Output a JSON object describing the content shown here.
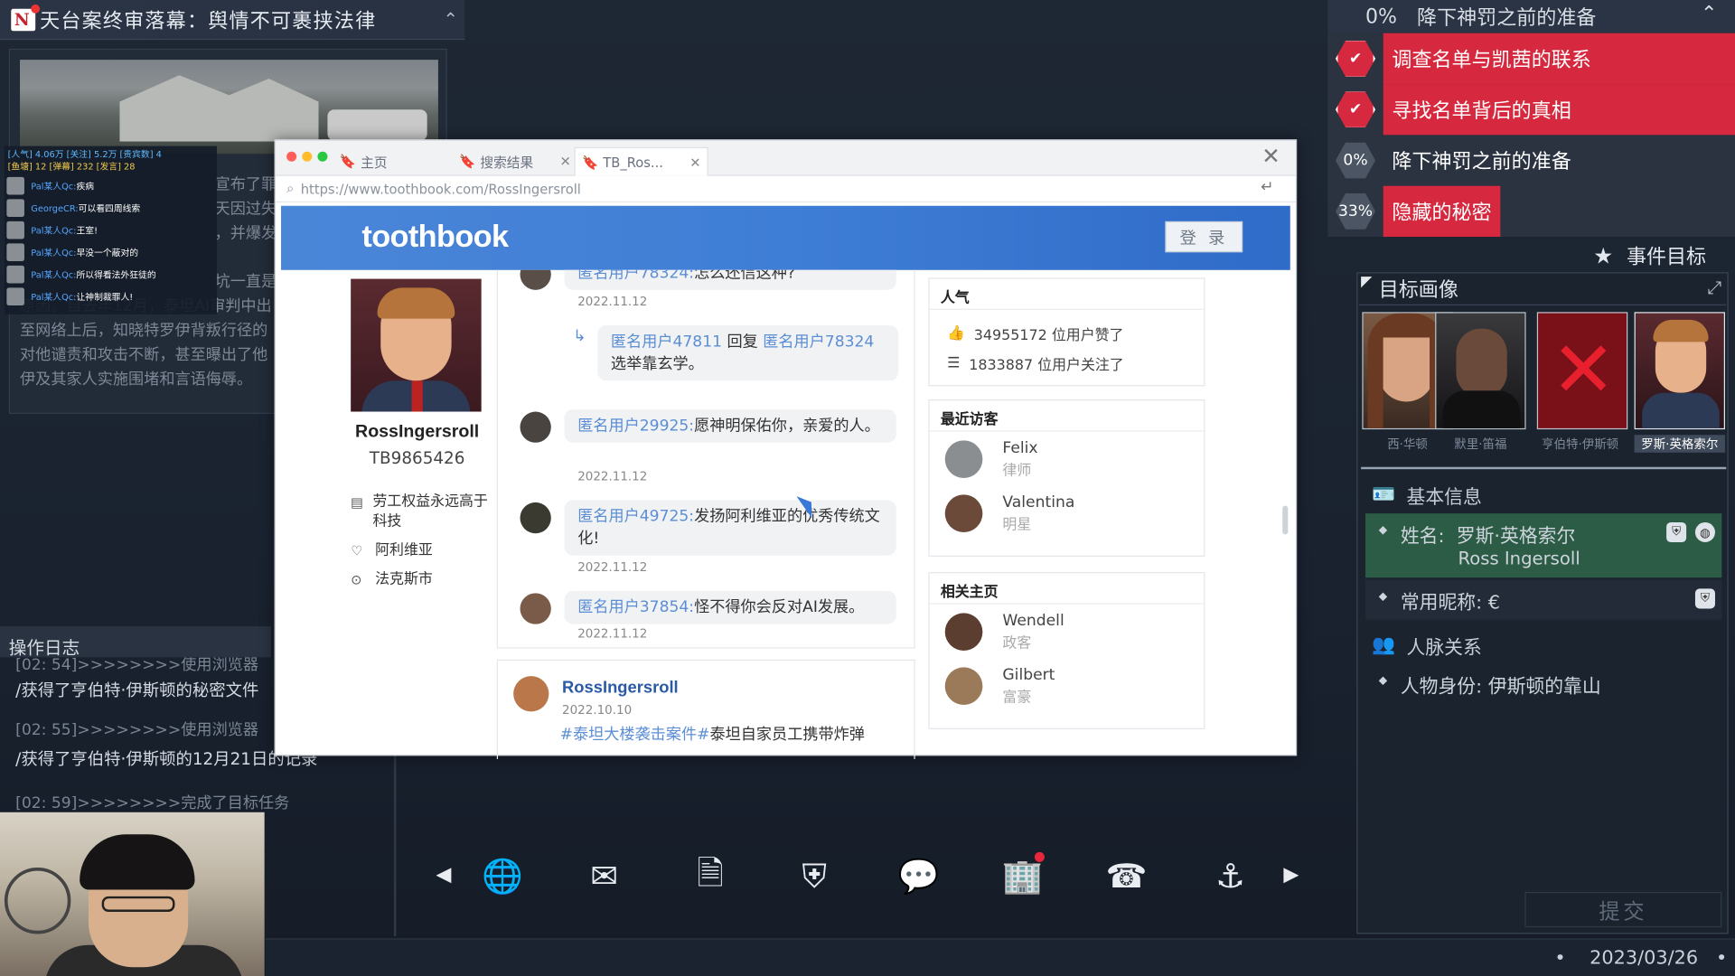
{
  "header": {
    "title": "天台案终审落幕：舆情不可裹挟法律"
  },
  "live": {
    "stats": "[人气] 4.06万 [关注] 5.2万 [贵宾数] 4",
    "stats2": "[鱼塘] 12 [弹幕] 232 [发言] 28",
    "messages": [
      {
        "name": "Pal某人Qc:",
        "text": "疾病"
      },
      {
        "name": "GeorgeCR:",
        "text": "可以看四周线索"
      },
      {
        "name": "Pal某人Qc:",
        "text": "王室!"
      },
      {
        "name": "Pal某人Qc:",
        "text": "早没一个蔽对的"
      },
      {
        "name": "Pal某人Qc:",
        "text": "所以得看法外狂徒的"
      },
      {
        "name": "Pal某人Qc:",
        "text": "让神制裁罪人!"
      }
    ]
  },
  "article_lines": [
    "宣布了罪",
    "天因过失",
    "，并爆发",
    "坑一直是",
    "原因。自去年12月，泰坦AI审判中出",
    "至网络上后，知晓特罗伊背叛行径的",
    "对他谴责和攻击不断，甚至曝出了他",
    "伊及其家人实施围堵和言语侮辱。"
  ],
  "oplog": {
    "title": "操作日志",
    "entries": [
      {
        "kind": "g",
        "text": "[02: 54]>>>>>>>>使用浏览器"
      },
      {
        "kind": "w",
        "text": "/获得了亨伯特·伊斯顿的秘密文件"
      },
      {
        "kind": "g",
        "text": "[02: 55]>>>>>>>>使用浏览器"
      },
      {
        "kind": "w",
        "text": "/获得了亨伯特·伊斯顿的12月21日的记录"
      },
      {
        "kind": "g",
        "text": "[02: 59]>>>>>>>>完成了目标任务"
      }
    ]
  },
  "browser": {
    "tabs": [
      "主页",
      "搜索结果",
      "TB_Ros..."
    ],
    "url": "https://www.toothbook.com/RossIngersroll",
    "brand": "toothbook",
    "login": "登 录",
    "profile": {
      "name": "RossIngersroll",
      "id": "TB9865426",
      "company": "劳工权益永远高于科技",
      "likes": "阿利维亚",
      "location": "法克斯市"
    },
    "comments": [
      {
        "user": "匿名用户78324:",
        "text": "怎么还信这种?",
        "date": "2022.11.12"
      },
      {
        "user": "匿名用户47811",
        "reply": "回复",
        "to": "匿名用户78324",
        "text": "选举靠玄学。"
      },
      {
        "user": "匿名用户29925:",
        "text": "愿神明保佑你，亲爱的人。",
        "date": "2022.11.12"
      },
      {
        "user": "匿名用户49725:",
        "text": "发扬阿利维亚的优秀传统文化!",
        "date": "2022.11.12"
      },
      {
        "user": "匿名用户37854:",
        "text": "怪不得你会反对AI发展。",
        "date": "2022.11.12"
      }
    ],
    "post": {
      "author": "RossIngersroll",
      "date": "2022.10.10",
      "tag": "#泰坦大楼袭击案件#",
      "text": "泰坦自家员工携带炸弹"
    },
    "popularity": {
      "title": "人气",
      "likes": "34955172 位用户赞了",
      "follows": "1833887 位用户关注了"
    },
    "visitors": {
      "title": "最近访客",
      "items": [
        {
          "name": "Felix",
          "role": "律师"
        },
        {
          "name": "Valentina",
          "role": "明星"
        }
      ]
    },
    "related": {
      "title": "相关主页",
      "items": [
        {
          "name": "Wendell",
          "role": "政客"
        },
        {
          "name": "Gilbert",
          "role": "富豪"
        }
      ]
    }
  },
  "tasks": {
    "header_pct": "0%",
    "header_label": "降下神罚之前的准备",
    "items": [
      {
        "badge": "✔",
        "label": "调查名单与凯茜的联系",
        "color": "#d6283e",
        "badgebg": "#d6283e"
      },
      {
        "badge": "✔",
        "label": "寻找名单背后的真相",
        "color": "#d6283e",
        "badgebg": "#d6283e"
      },
      {
        "badge": "0%",
        "label": "降下神罚之前的准备",
        "color": "#2b3340",
        "badgebg": "#4b5564"
      },
      {
        "badge": "33%",
        "label": "隐藏的秘密",
        "color": "#d6283e",
        "badgebg": "#4b5564"
      }
    ],
    "event_title": "事件目标"
  },
  "target": {
    "title": "目标画像",
    "portraits": [
      "西·华顿",
      "默里·笛福",
      "亨伯特·伊斯顿",
      "罗斯·英格索尔"
    ],
    "basic_title": "基本信息",
    "name_label": "姓名:",
    "name_value": "罗斯·英格索尔",
    "name_en": "Ross Ingersoll",
    "nick_label": "常用昵称:",
    "nick_value": "€",
    "relation_title": "人脉关系",
    "relation_label": "人物身份:",
    "relation_value": "伊斯顿的靠山",
    "submit": "提交"
  },
  "date": "2023/03/26"
}
